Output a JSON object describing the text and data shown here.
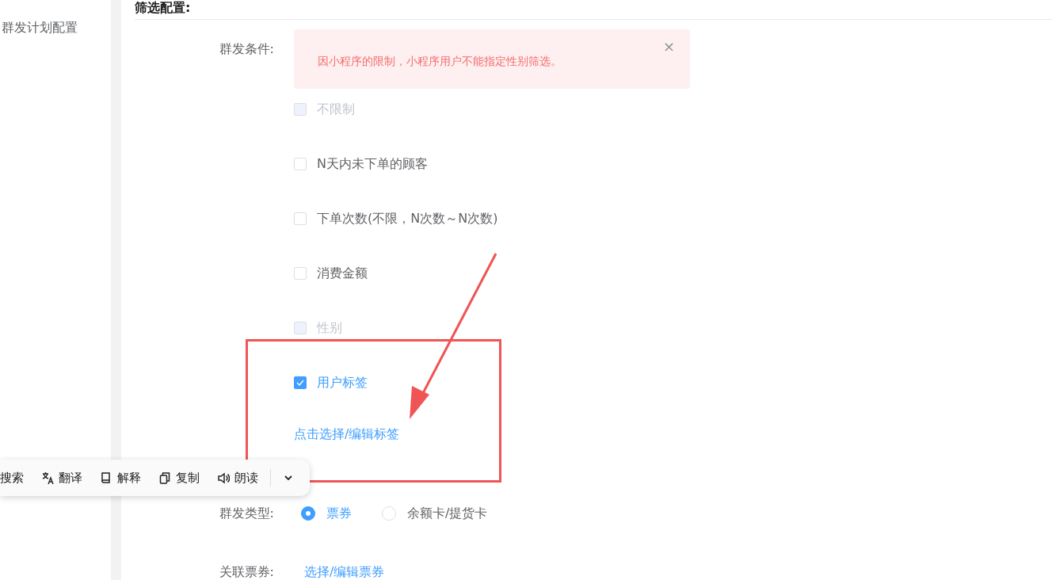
{
  "sidebar": {
    "items": [
      {
        "label": "群发计划配置"
      }
    ]
  },
  "section": {
    "title": "筛选配置:"
  },
  "conditions": {
    "label": "群发条件:",
    "alert": {
      "text": "因小程序的限制，小程序用户不能指定性别筛选。",
      "close": "×"
    },
    "options": [
      {
        "label": "不限制",
        "checked": false,
        "disabled": true
      },
      {
        "label": "N天内未下单的顾客",
        "checked": false,
        "disabled": false
      },
      {
        "label": "下单次数(不限，N次数～N次数)",
        "checked": false,
        "disabled": false
      },
      {
        "label": "消费金额",
        "checked": false,
        "disabled": false
      },
      {
        "label": "性别",
        "checked": false,
        "disabled": true
      },
      {
        "label": "用户标签",
        "checked": true,
        "disabled": false
      }
    ],
    "link": "点击选择/编辑标签"
  },
  "send_type": {
    "label": "群发类型:",
    "options": [
      {
        "label": "票券",
        "selected": true
      },
      {
        "label": "余额卡/提货卡",
        "selected": false
      }
    ]
  },
  "voucher": {
    "label": "关联票券:",
    "link": "选择/编辑票券"
  },
  "toolbar": {
    "items": [
      {
        "kind": "search",
        "label": "搜索"
      },
      {
        "kind": "translate",
        "label": "翻译"
      },
      {
        "kind": "explain",
        "label": "解释"
      },
      {
        "kind": "copy",
        "label": "复制"
      },
      {
        "kind": "read",
        "label": "朗读"
      },
      {
        "kind": "more"
      }
    ]
  }
}
